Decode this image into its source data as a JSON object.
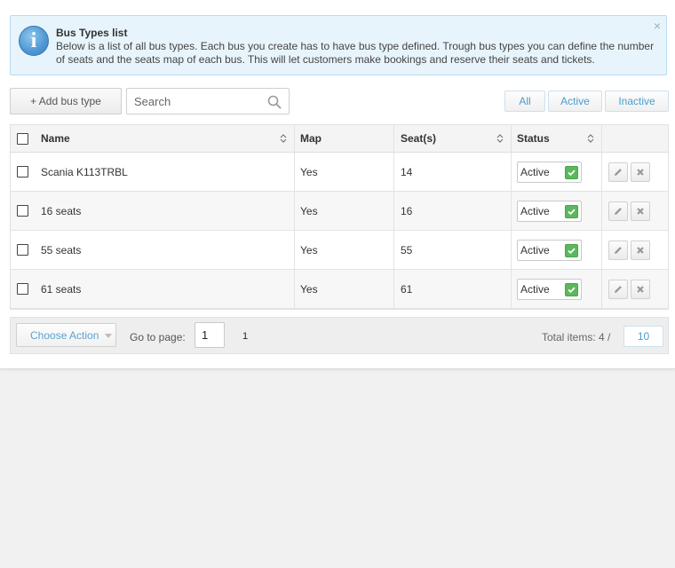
{
  "info": {
    "title": "Bus Types list",
    "text": "Below is a list of all bus types. Each bus you create has to have bus type defined. Trough bus types you can define the number of seats and the seats map of each bus. This will let customers make bookings and reserve their seats and tickets.",
    "icon": "info-icon",
    "close": "×"
  },
  "toolbar": {
    "add_label": "+ Add bus type",
    "search_placeholder": "Search",
    "filters": [
      "All",
      "Active",
      "Inactive"
    ]
  },
  "table": {
    "headers": {
      "name": "Name",
      "map": "Map",
      "seats": "Seat(s)",
      "status": "Status"
    },
    "rows": [
      {
        "name": "Scania K113TRBL",
        "map": "Yes",
        "seats": "14",
        "status": "Active"
      },
      {
        "name": "16 seats",
        "map": "Yes",
        "seats": "16",
        "status": "Active"
      },
      {
        "name": "55 seats",
        "map": "Yes",
        "seats": "55",
        "status": "Active"
      },
      {
        "name": "61 seats",
        "map": "Yes",
        "seats": "61",
        "status": "Active"
      }
    ]
  },
  "footer": {
    "choose_action": "Choose Action",
    "goto_label": "Go to page:",
    "goto_value": "1",
    "page": "1",
    "total_label": "Total items: 4 /",
    "per_page": "10"
  },
  "colors": {
    "accent": "#4a9ccf",
    "status_green": "#5cb85c",
    "info_bg": "#e8f4fb"
  }
}
